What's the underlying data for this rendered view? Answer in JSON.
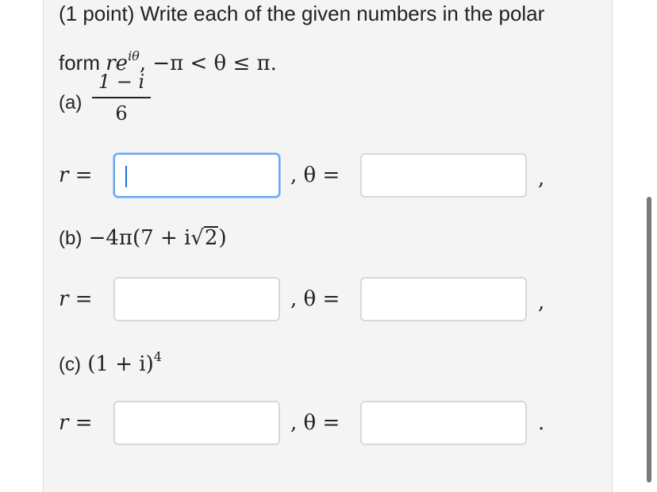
{
  "problem": {
    "intro_line1": "(1 point) Write each of the given numbers in the polar",
    "intro_form_word": "form ",
    "polar_form": "re",
    "polar_exp": "iθ",
    "constraint": ", −π < θ ≤ π."
  },
  "parts": [
    {
      "label": "(a)",
      "numerator": "1 − i",
      "denominator": "6",
      "r_label": "r =",
      "theta_label": ", θ =",
      "separator": ",",
      "r_value": "",
      "theta_value": ""
    },
    {
      "label": "(b)",
      "expr_prefix": " −4π(7 + i",
      "sqrt_symbol": "√",
      "sqrt_arg": "2",
      "expr_suffix": ")",
      "r_label": "r =",
      "theta_label": ", θ =",
      "separator": ",",
      "r_value": "",
      "theta_value": ""
    },
    {
      "label": "(c)",
      "expr": " (1 + i)",
      "exponent": "4",
      "r_label": "r =",
      "theta_label": ", θ =",
      "separator": ".",
      "r_value": "",
      "theta_value": ""
    }
  ],
  "colors": {
    "panel_bg": "#f4f4f4",
    "focus_border": "#6aa6f2",
    "input_border": "#d8d8d8"
  }
}
